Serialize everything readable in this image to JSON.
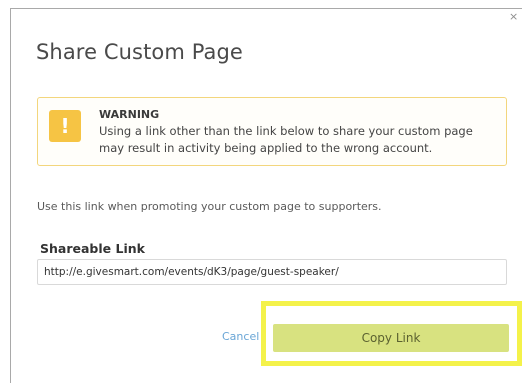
{
  "dialog": {
    "title": "Share Custom Page",
    "close_symbol": "×"
  },
  "warning": {
    "icon": "exclamation-icon",
    "icon_glyph": "!",
    "heading": "WARNING",
    "message": "Using a link other than the link below to share your custom page may result in activity being applied to the wrong account."
  },
  "instructions": "Use this link when promoting your custom page to supporters.",
  "shareable_link": {
    "label": "Shareable Link",
    "value": "http://e.givesmart.com/events/dK3/page/guest-speaker/"
  },
  "actions": {
    "cancel_label": "Cancel",
    "copy_label": "Copy Link"
  },
  "colors": {
    "warning_accent": "#f6c444",
    "copy_button": "#d8e280",
    "highlight": "#f4f24a",
    "cancel_link": "#6aa6d6"
  }
}
